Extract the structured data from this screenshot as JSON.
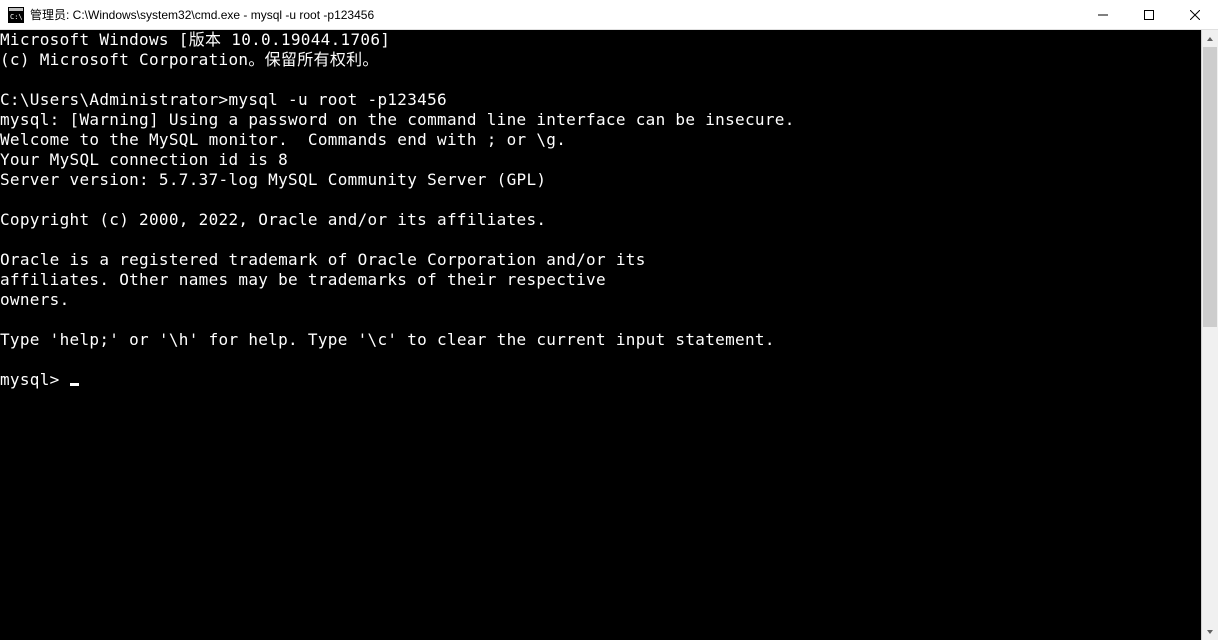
{
  "titlebar": {
    "text": "管理员: C:\\Windows\\system32\\cmd.exe - mysql  -u root -p123456"
  },
  "console": {
    "lines": [
      "Microsoft Windows [版本 10.0.19044.1706]",
      "(c) Microsoft Corporation。保留所有权利。",
      "",
      "C:\\Users\\Administrator>mysql -u root -p123456",
      "mysql: [Warning] Using a password on the command line interface can be insecure.",
      "Welcome to the MySQL monitor.  Commands end with ; or \\g.",
      "Your MySQL connection id is 8",
      "Server version: 5.7.37-log MySQL Community Server (GPL)",
      "",
      "Copyright (c) 2000, 2022, Oracle and/or its affiliates.",
      "",
      "Oracle is a registered trademark of Oracle Corporation and/or its",
      "affiliates. Other names may be trademarks of their respective",
      "owners.",
      "",
      "Type 'help;' or '\\h' for help. Type '\\c' to clear the current input statement.",
      ""
    ],
    "prompt": "mysql> "
  }
}
